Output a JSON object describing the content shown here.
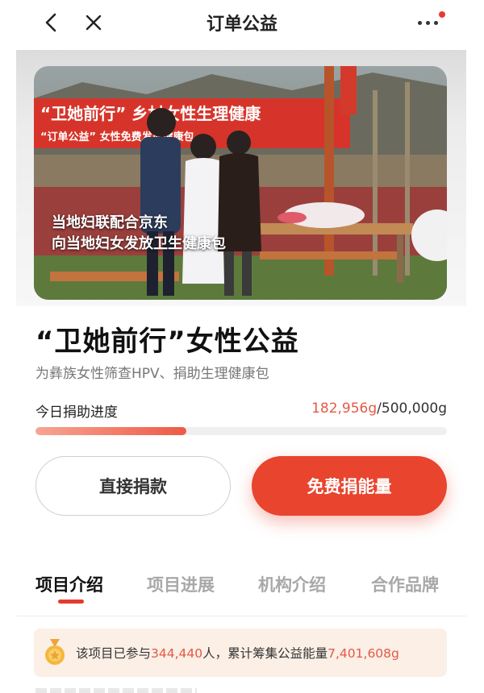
{
  "header": {
    "title": "订单公益"
  },
  "hero": {
    "banner_text": "“卫她前行” 乡村女性生理健康",
    "banner_sub": "“订单公益” 女性免费发放健康包",
    "caption_line1": "当地妇联配合京东",
    "caption_line2": "向当地妇女发放卫生健康包"
  },
  "project": {
    "title": "“卫她前行”女性公益",
    "subtitle": "为彝族女性筛查HPV、捐助生理健康包"
  },
  "progress": {
    "label": "今日捐助进度",
    "current": "182,956g",
    "separator": "/",
    "goal": "500,000g",
    "fraction": 0.366
  },
  "actions": {
    "direct_label": "直接捐款",
    "free_label": "免费捐能量"
  },
  "tabs": [
    {
      "label": "项目介绍",
      "active": true
    },
    {
      "label": "项目进展",
      "active": false
    },
    {
      "label": "机构介绍",
      "active": false
    },
    {
      "label": "合作品牌",
      "active": false
    }
  ],
  "stats": {
    "prefix": "该项目已参与",
    "participants": "344,440",
    "middle": "人，累计筹集公益能量",
    "energy": "7,401,608g",
    "icon": "medal-icon"
  },
  "colors": {
    "accent": "#e8442e",
    "highlight": "#e35a45"
  }
}
